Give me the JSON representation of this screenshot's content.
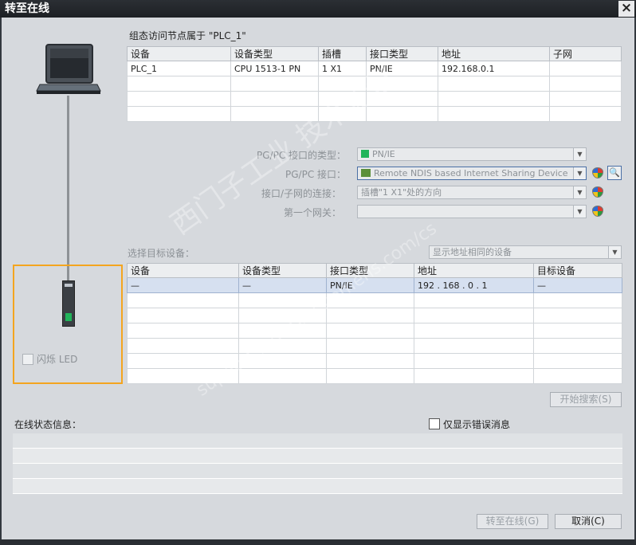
{
  "window": {
    "title": "转至在线",
    "close": "×"
  },
  "config": {
    "heading": "组态访问节点属于 \"PLC_1\"",
    "columns": [
      "设备",
      "设备类型",
      "插槽",
      "接口类型",
      "地址",
      "子网"
    ],
    "rows": [
      [
        "PLC_1",
        "CPU 1513-1 PN",
        "1 X1",
        "PN/IE",
        "192.168.0.1",
        ""
      ],
      [
        "",
        "",
        "",
        "",
        "",
        ""
      ],
      [
        "",
        "",
        "",
        "",
        "",
        ""
      ],
      [
        "",
        "",
        "",
        "",
        "",
        ""
      ]
    ]
  },
  "interface": {
    "type_label": "PG/PC 接口的类型：",
    "type_value": "PN/IE",
    "pgpc_label": "PG/PC 接口：",
    "pgpc_value": "Remote NDIS based Internet Sharing Device",
    "conn_label": "接口/子网的连接：",
    "conn_value": "插槽\"1 X1\"处的方向",
    "gateway_label": "第一个网关：",
    "gateway_value": ""
  },
  "target": {
    "label": "选择目标设备：",
    "filter_value": "显示地址相同的设备",
    "columns": [
      "设备",
      "设备类型",
      "接口类型",
      "地址",
      "目标设备"
    ],
    "rows": [
      [
        "—",
        "—",
        "PN/IE",
        "192 . 168 . 0    . 1",
        "—"
      ],
      [
        "",
        "",
        "",
        "",
        ""
      ],
      [
        "",
        "",
        "",
        "",
        ""
      ],
      [
        "",
        "",
        "",
        "",
        ""
      ],
      [
        "",
        "",
        "",
        "",
        ""
      ],
      [
        "",
        "",
        "",
        "",
        ""
      ],
      [
        "",
        "",
        "",
        "",
        ""
      ]
    ]
  },
  "flash_led": "闪烁 LED",
  "start_search": "开始搜索(S)",
  "online_status": "在线状态信息：",
  "only_errors": "仅显示错误消息",
  "buttons": {
    "go_online": "转至在线(G)",
    "cancel": "取消(C)"
  },
  "watermark": {
    "line1": "西门子工业  技术论坛",
    "line2": "support.industry.siemens.com/cs"
  },
  "colors": {
    "highlight": "#f4a51f",
    "selection": "#d6e0f0",
    "network_green": "#21b45a"
  }
}
